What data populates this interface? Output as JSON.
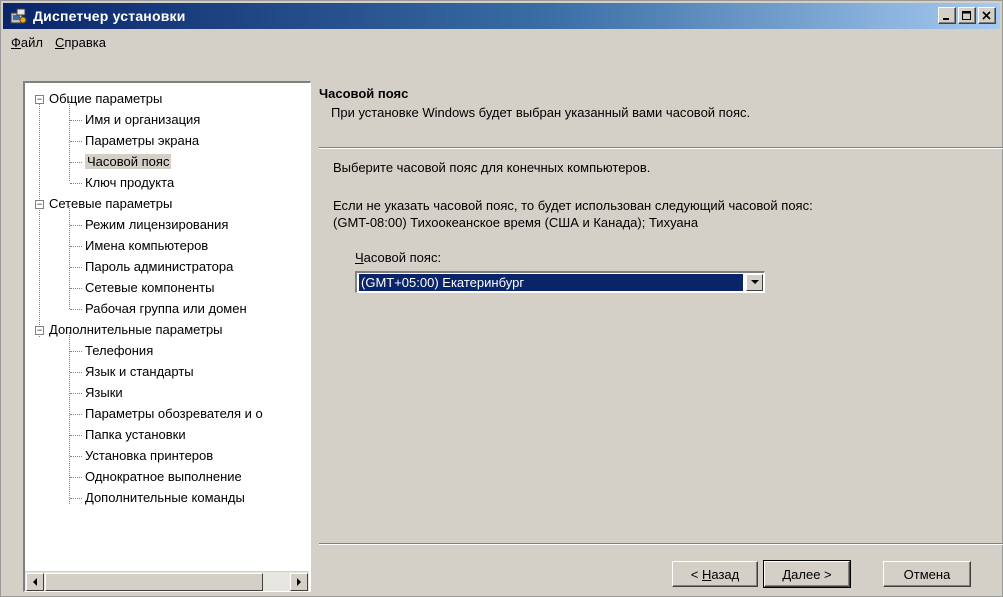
{
  "window": {
    "title": "Диспетчер установки"
  },
  "menu": [
    {
      "label_ul": "Ф",
      "label_rest": "айл"
    },
    {
      "label_ul": "С",
      "label_rest": "правка"
    }
  ],
  "tree": {
    "groups": [
      {
        "label": "Общие параметры",
        "expanded": true,
        "items": [
          "Имя и организация",
          "Параметры экрана",
          "Часовой пояс",
          "Ключ продукта"
        ]
      },
      {
        "label": "Сетевые параметры",
        "expanded": true,
        "items": [
          "Режим лицензирования",
          "Имена компьютеров",
          "Пароль администратора",
          "Сетевые компоненты",
          "Рабочая группа или домен"
        ]
      },
      {
        "label": "Дополнительные параметры",
        "expanded": true,
        "items": [
          "Телефония",
          "Язык и стандарты",
          "Языки",
          "Параметры обозревателя и о",
          "Папка установки",
          "Установка принтеров",
          "Однократное выполнение",
          "Дополнительные команды"
        ]
      }
    ],
    "selected": "Часовой пояс"
  },
  "page": {
    "title": "Часовой пояс",
    "subtitle": "При установке Windows будет выбран указанный вами часовой пояс.",
    "instruction": "Выберите часовой пояс для конечных компьютеров.",
    "note_line1": "Если не указать часовой пояс, то будет использован следующий часовой пояс:",
    "note_line2": "(GMT-08:00) Тихоокеанское время (США и Канада); Тихуана",
    "field_label_ul": "Ч",
    "field_label_rest": "асовой пояс:",
    "timezone_value": "(GMT+05:00) Екатеринбург"
  },
  "buttons": {
    "back_prefix": "< ",
    "back_ul": "Н",
    "back_rest": "азад",
    "next_ul": "Д",
    "next_rest": "алее >",
    "cancel": "Отмена"
  }
}
